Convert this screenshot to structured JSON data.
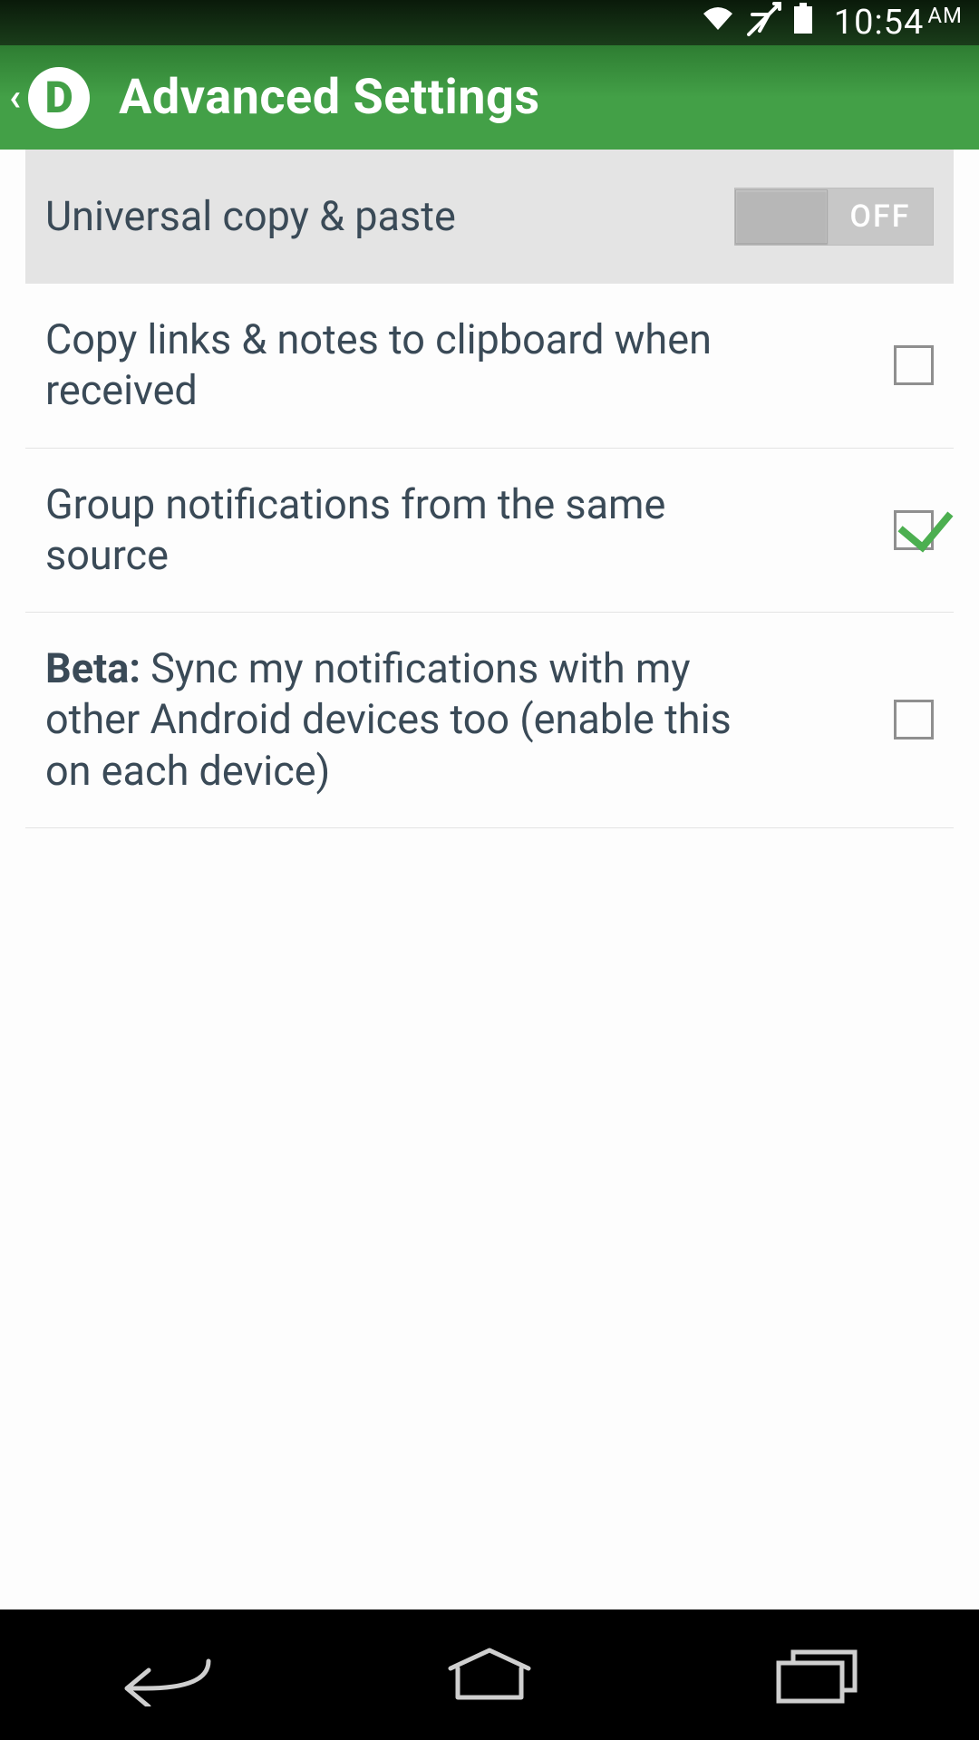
{
  "statusbar": {
    "time": "10:54",
    "ampm": "AM"
  },
  "header": {
    "title": "Advanced Settings",
    "app_icon_letter": "D"
  },
  "settings": {
    "universal_copy": {
      "label": "Universal copy & paste",
      "toggle_text": "OFF",
      "value": false
    },
    "copy_links": {
      "label": "Copy links & notes to clipboard when received",
      "checked": false
    },
    "group_notifications": {
      "label": "Group notifications from the same source",
      "checked": true
    },
    "beta_sync": {
      "bold": "Beta:",
      "rest": " Sync my notifications with my other Android devices too (enable this on each device)",
      "checked": false
    }
  }
}
